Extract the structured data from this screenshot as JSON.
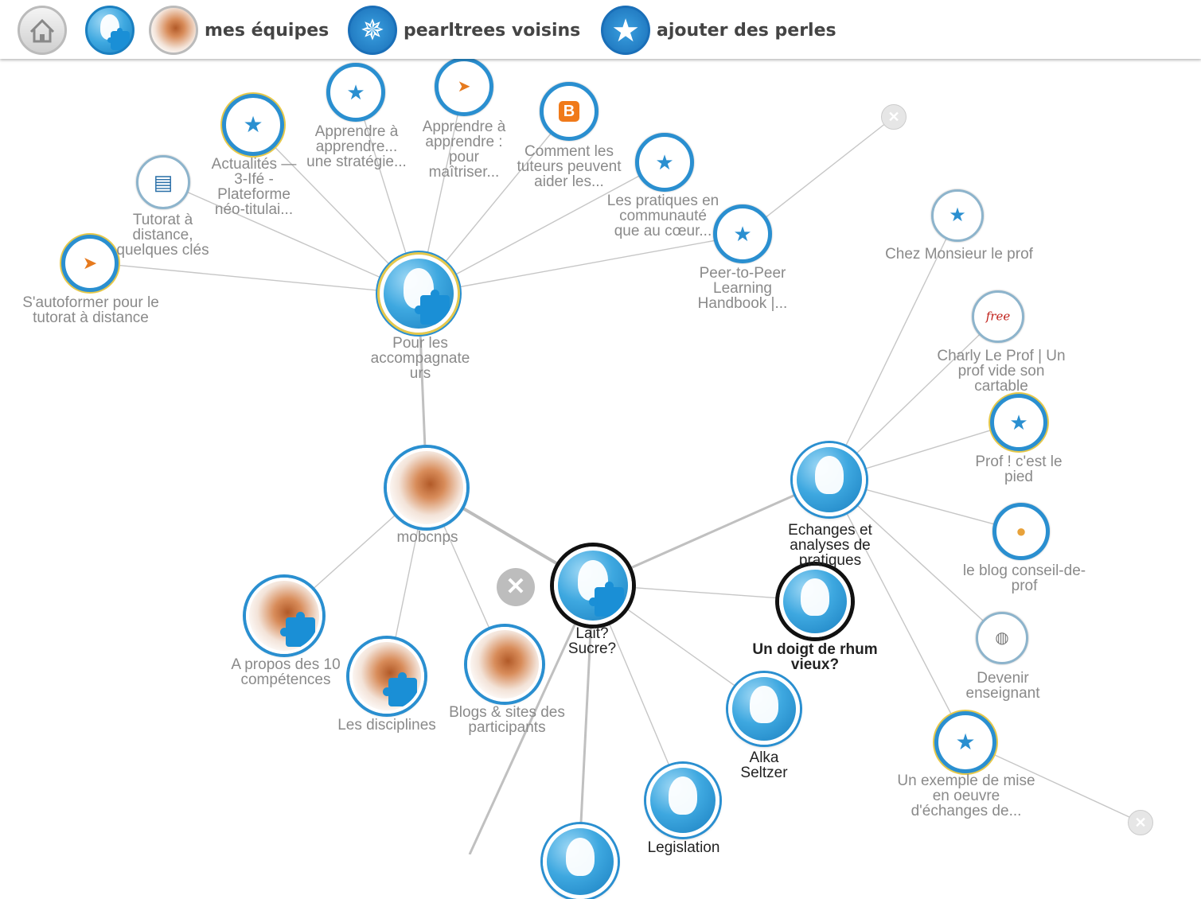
{
  "toolbar": {
    "home_icon": "home-icon",
    "my_tree_icon": "pearltree-head-icon",
    "teams_label": "mes équipes",
    "neighbors_label": "pearltrees voisins",
    "add_label": "ajouter des perles"
  },
  "nodes": {
    "pour_les": "Pour les accompagnate urs",
    "mobcnps": "mobcnps",
    "lait_sucre": "Lait? Sucre?",
    "doigt_rhum": "Un doigt de rhum vieux?",
    "echanges": "Echanges et analyses de pratiques",
    "alka": "Alka Seltzer",
    "legislation": "Legislation",
    "a_propos": "A propos des 10 compétences",
    "disciplines": "Les disciplines",
    "blogs": "Blogs & sites des participants",
    "sautoformer": "S'autoformer pour le tutorat à distance",
    "tutorat": "Tutorat à distance, quelques clés",
    "actualites": "Actualités — 3-Ifé - Plateforme néo-titulai...",
    "apprendre1": "Apprendre à apprendre... une stratégie...",
    "apprendre2": "Apprendre à apprendre : pour maîtriser...",
    "comment": "Comment les tuteurs peuvent aider les...",
    "pratiques": "Les pratiques en communauté que au cœur...",
    "peer": "Peer-to-Peer Learning Handbook |...",
    "chez": "Chez Monsieur le prof",
    "charly": "Charly Le Prof | Un prof vide son cartable",
    "prof_pied": "Prof ! c'est le pied",
    "blog_conseil": "le blog conseil-de-prof",
    "devenir": "Devenir enseignant",
    "exemple": "Un exemple de mise en oeuvre d'échanges de..."
  },
  "icons": {
    "free_badge": "free",
    "close": "close-icon",
    "star": "star-icon",
    "blogger": "blogger-icon",
    "bird": "bird-icon"
  },
  "colors": {
    "accent": "#2a8fd0",
    "label": "#8a8a8a",
    "topbar_text": "#444444"
  }
}
